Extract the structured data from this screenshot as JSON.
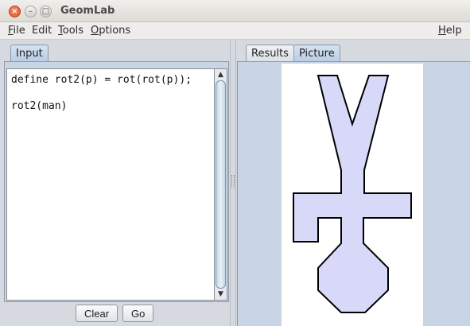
{
  "window": {
    "title": "GeomLab",
    "close_glyph": "×",
    "min_glyph": "–",
    "max_glyph": "□"
  },
  "menubar": {
    "file": {
      "mnemonic": "F",
      "rest": "ile"
    },
    "edit": {
      "mnemonic": "",
      "rest": "Edit"
    },
    "tools": {
      "mnemonic": "T",
      "rest": "ools"
    },
    "options": {
      "mnemonic": "O",
      "rest": "ptions"
    },
    "help": {
      "mnemonic": "H",
      "rest": "elp"
    }
  },
  "input_panel": {
    "tab_label": "Input",
    "code_lines": [
      "define rot2(p) = rot(rot(p));",
      "",
      "rot2(man)"
    ],
    "scroll_up_glyph": "▲",
    "scroll_down_glyph": "▼",
    "clear_label": "Clear",
    "go_label": "Go"
  },
  "output_panel": {
    "tabs": [
      {
        "label": "Results",
        "active": false
      },
      {
        "label": "Picture",
        "active": true
      }
    ],
    "picture": {
      "shape": "man rotated 180 degrees",
      "fill": "#d8d8f8",
      "stroke": "#000000",
      "background": "#ffffff"
    }
  }
}
